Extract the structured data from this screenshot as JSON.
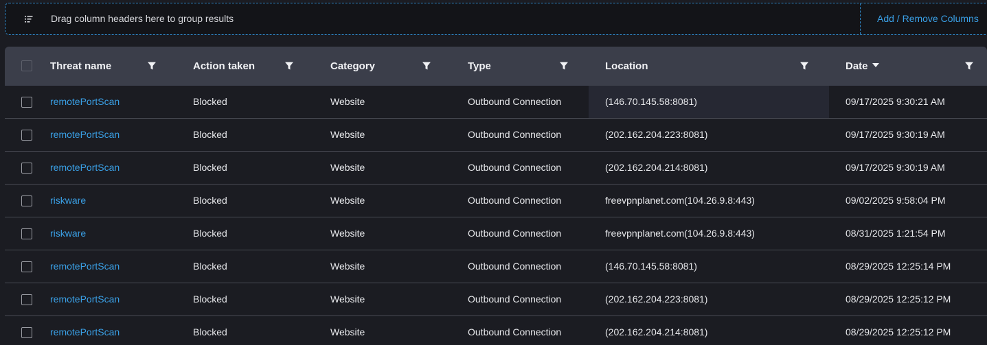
{
  "group_bar": {
    "hint": "Drag column headers here to group results",
    "add_remove_label": "Add / Remove Columns",
    "icon": "group-list-icon"
  },
  "columns": [
    {
      "key": "threat_name",
      "label": "Threat name"
    },
    {
      "key": "action_taken",
      "label": "Action taken"
    },
    {
      "key": "category",
      "label": "Category"
    },
    {
      "key": "type",
      "label": "Type"
    },
    {
      "key": "location",
      "label": "Location"
    },
    {
      "key": "date",
      "label": "Date",
      "sorted": "descending"
    }
  ],
  "rows": [
    {
      "threat_name": "remotePortScan",
      "action_taken": "Blocked",
      "category": "Website",
      "type": "Outbound Connection",
      "location": "(146.70.145.58:8081)",
      "date": "09/17/2025 9:30:21 AM"
    },
    {
      "threat_name": "remotePortScan",
      "action_taken": "Blocked",
      "category": "Website",
      "type": "Outbound Connection",
      "location": "(202.162.204.223:8081)",
      "date": "09/17/2025 9:30:19 AM"
    },
    {
      "threat_name": "remotePortScan",
      "action_taken": "Blocked",
      "category": "Website",
      "type": "Outbound Connection",
      "location": "(202.162.204.214:8081)",
      "date": "09/17/2025 9:30:19 AM"
    },
    {
      "threat_name": "riskware",
      "action_taken": "Blocked",
      "category": "Website",
      "type": "Outbound Connection",
      "location": "freevpnplanet.com(104.26.9.8:443)",
      "date": "09/02/2025 9:58:04 PM"
    },
    {
      "threat_name": "riskware",
      "action_taken": "Blocked",
      "category": "Website",
      "type": "Outbound Connection",
      "location": "freevpnplanet.com(104.26.9.8:443)",
      "date": "08/31/2025 1:21:54 PM"
    },
    {
      "threat_name": "remotePortScan",
      "action_taken": "Blocked",
      "category": "Website",
      "type": "Outbound Connection",
      "location": "(146.70.145.58:8081)",
      "date": "08/29/2025 12:25:14 PM"
    },
    {
      "threat_name": "remotePortScan",
      "action_taken": "Blocked",
      "category": "Website",
      "type": "Outbound Connection",
      "location": "(202.162.204.223:8081)",
      "date": "08/29/2025 12:25:12 PM"
    },
    {
      "threat_name": "remotePortScan",
      "action_taken": "Blocked",
      "category": "Website",
      "type": "Outbound Connection",
      "location": "(202.162.204.214:8081)",
      "date": "08/29/2025 12:25:12 PM"
    }
  ],
  "colors": {
    "accent": "#3aa0e6",
    "header_bg": "#3b3e4a",
    "body_bg": "#1b1c22"
  }
}
